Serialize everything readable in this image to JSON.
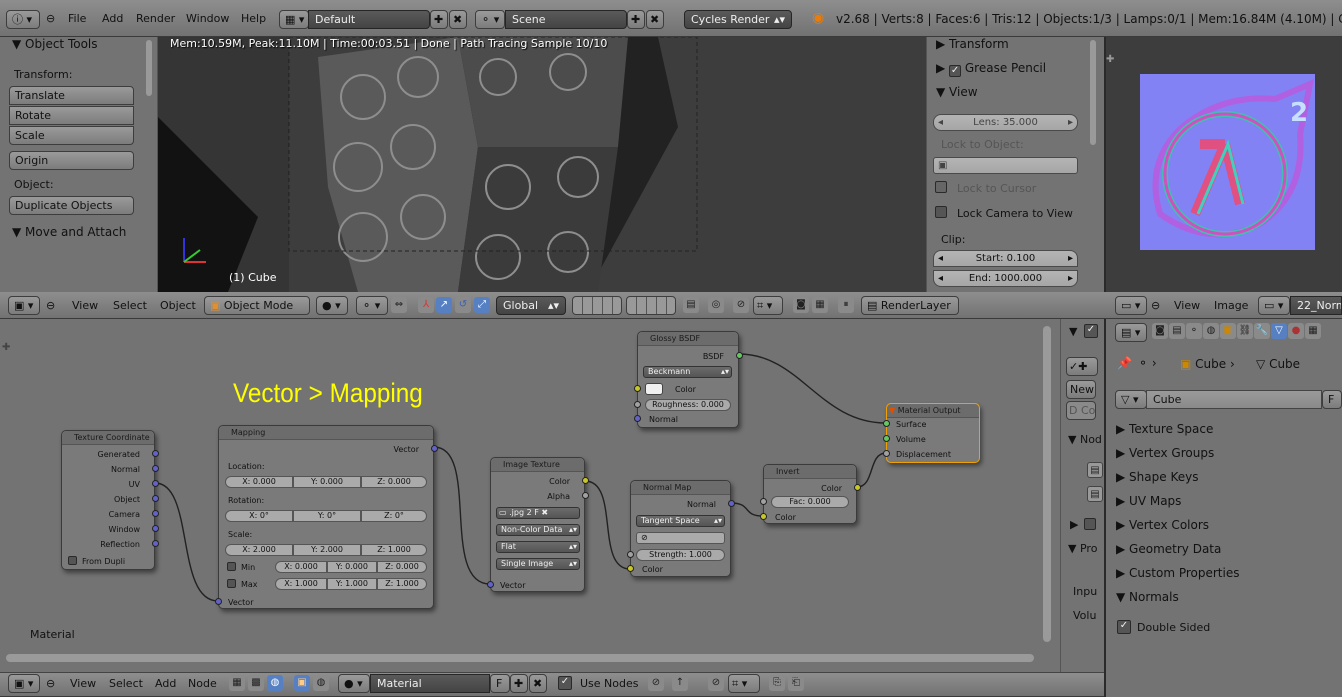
{
  "topbar": {
    "menus": [
      "File",
      "Add",
      "Render",
      "Window",
      "Help"
    ],
    "layout": "Default",
    "scene": "Scene",
    "engine": "Cycles Render",
    "stats": "v2.68 | Verts:8 | Faces:6 | Tris:12 | Objects:1/3 | Lamps:0/1 | Mem:16.84M (4.10M) | Cube"
  },
  "toolshelf": {
    "title": "Object Tools",
    "transform_label": "Transform:",
    "buttons": [
      "Translate",
      "Rotate",
      "Scale",
      "Origin"
    ],
    "object_label": "Object:",
    "duplicate": "Duplicate Objects",
    "move_attach": "Move and Attach"
  },
  "viewport": {
    "render_info": "Mem:10.59M, Peak:11.10M | Time:00:03.51 | Done | Path Tracing Sample 10/10",
    "object_name": "(1) Cube"
  },
  "nprops": {
    "transform": "Transform",
    "grease_pencil": "Grease Pencil",
    "view": "View",
    "lens": "Lens: 35.000",
    "lock_to_object": "Lock to Object:",
    "lock_to_cursor": "Lock to Cursor",
    "lock_camera": "Lock Camera to View",
    "clip": "Clip:",
    "start": "Start: 0.100",
    "end": "End: 1000.000"
  },
  "view3d_header": {
    "menus": [
      "View",
      "Select",
      "Object"
    ],
    "mode": "Object Mode",
    "orientation": "Global",
    "render_layer": "RenderLayer"
  },
  "image_header": {
    "menus": [
      "View",
      "Image"
    ],
    "image_name": "22_Norm"
  },
  "node_editor": {
    "annotation": "Vector > Mapping",
    "material_label": "Material",
    "texcoord": {
      "title": "Texture Coordinate",
      "outputs": [
        "Generated",
        "Normal",
        "UV",
        "Object",
        "Camera",
        "Window",
        "Reflection"
      ],
      "from_dupli": "From Dupli"
    },
    "mapping": {
      "title": "Mapping",
      "out": "Vector",
      "location": "Location:",
      "loc": [
        "X: 0.000",
        "Y: 0.000",
        "Z: 0.000"
      ],
      "rotation": "Rotation:",
      "rot": [
        "X: 0°",
        "Y: 0°",
        "Z: 0°"
      ],
      "scale": "Scale:",
      "scl": [
        "X: 2.000",
        "Y: 2.000",
        "Z: 1.000"
      ],
      "min": "Min",
      "mins": [
        "X: 0.000",
        "Y: 0.000",
        "Z: 0.000"
      ],
      "max": "Max",
      "maxs": [
        "X: 1.000",
        "Y: 1.000",
        "Z: 1.000"
      ],
      "in": "Vector"
    },
    "image_texture": {
      "title": "Image Texture",
      "color": "Color",
      "alpha": "Alpha",
      "file": ".jpg",
      "users": "2",
      "fake": "F",
      "colorspace": "Non-Color Data",
      "interp": "Flat",
      "projection": "Single Image",
      "in": "Vector"
    },
    "glossy": {
      "title": "Glossy BSDF",
      "out": "BSDF",
      "dist": "Beckmann",
      "color": "Color",
      "roughness": "Roughness: 0.000",
      "normal": "Normal"
    },
    "normal_map": {
      "title": "Normal Map",
      "out": "Normal",
      "space": "Tangent Space",
      "strength": "Strength: 1.000",
      "color": "Color"
    },
    "invert": {
      "title": "Invert",
      "out": "Color",
      "fac": "Fac: 0.000",
      "color": "Color"
    },
    "output": {
      "title": "Material Output",
      "surface": "Surface",
      "volume": "Volume",
      "displacement": "Displacement"
    }
  },
  "node_sidebar": {
    "new": "New",
    "nod": "Nod",
    "pro": "Pro",
    "inpu": "Inpu",
    "volu": "Volu"
  },
  "node_header": {
    "menus": [
      "View",
      "Select",
      "Add",
      "Node"
    ],
    "material": "Material",
    "fake": "F",
    "use_nodes": "Use Nodes"
  },
  "properties": {
    "breadcrumb": [
      "Cube",
      "Cube"
    ],
    "mesh_name": "Cube",
    "fake": "F",
    "panels": [
      "Texture Space",
      "Vertex Groups",
      "Shape Keys",
      "UV Maps",
      "Vertex Colors",
      "Geometry Data",
      "Custom Properties",
      "Normals"
    ],
    "double_sided": "Double Sided"
  },
  "texture_preview": {
    "label": "2"
  }
}
